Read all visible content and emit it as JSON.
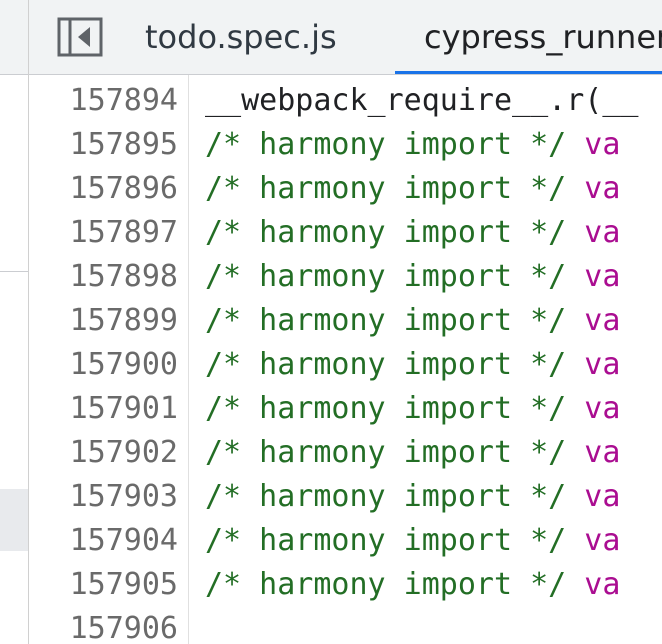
{
  "tabs": [
    {
      "label": "todo.spec.js",
      "active": false
    },
    {
      "label": "cypress_runner",
      "active": true
    }
  ],
  "toggle_navigator_icon": "sidebar-toggle-icon",
  "colors": {
    "comment": "#236e25",
    "keyword": "#aa0d91",
    "line_number": "#6a6a6a",
    "active_tab_underline": "#1a73e8"
  },
  "editor": {
    "lines": [
      {
        "number": "157894",
        "kind": "plain",
        "code": "__webpack_require__.r(__"
      },
      {
        "number": "157895",
        "kind": "import",
        "comment": "/* harmony import */",
        "keyword": "va"
      },
      {
        "number": "157896",
        "kind": "import",
        "comment": "/* harmony import */",
        "keyword": "va"
      },
      {
        "number": "157897",
        "kind": "import",
        "comment": "/* harmony import */",
        "keyword": "va"
      },
      {
        "number": "157898",
        "kind": "import",
        "comment": "/* harmony import */",
        "keyword": "va"
      },
      {
        "number": "157899",
        "kind": "import",
        "comment": "/* harmony import */",
        "keyword": "va"
      },
      {
        "number": "157900",
        "kind": "import",
        "comment": "/* harmony import */",
        "keyword": "va"
      },
      {
        "number": "157901",
        "kind": "import",
        "comment": "/* harmony import */",
        "keyword": "va"
      },
      {
        "number": "157902",
        "kind": "import",
        "comment": "/* harmony import */",
        "keyword": "va"
      },
      {
        "number": "157903",
        "kind": "import",
        "comment": "/* harmony import */",
        "keyword": "va"
      },
      {
        "number": "157904",
        "kind": "import",
        "comment": "/* harmony import */",
        "keyword": "va"
      },
      {
        "number": "157905",
        "kind": "import",
        "comment": "/* harmony import */",
        "keyword": "va"
      },
      {
        "number": "157906",
        "kind": "empty"
      }
    ]
  }
}
